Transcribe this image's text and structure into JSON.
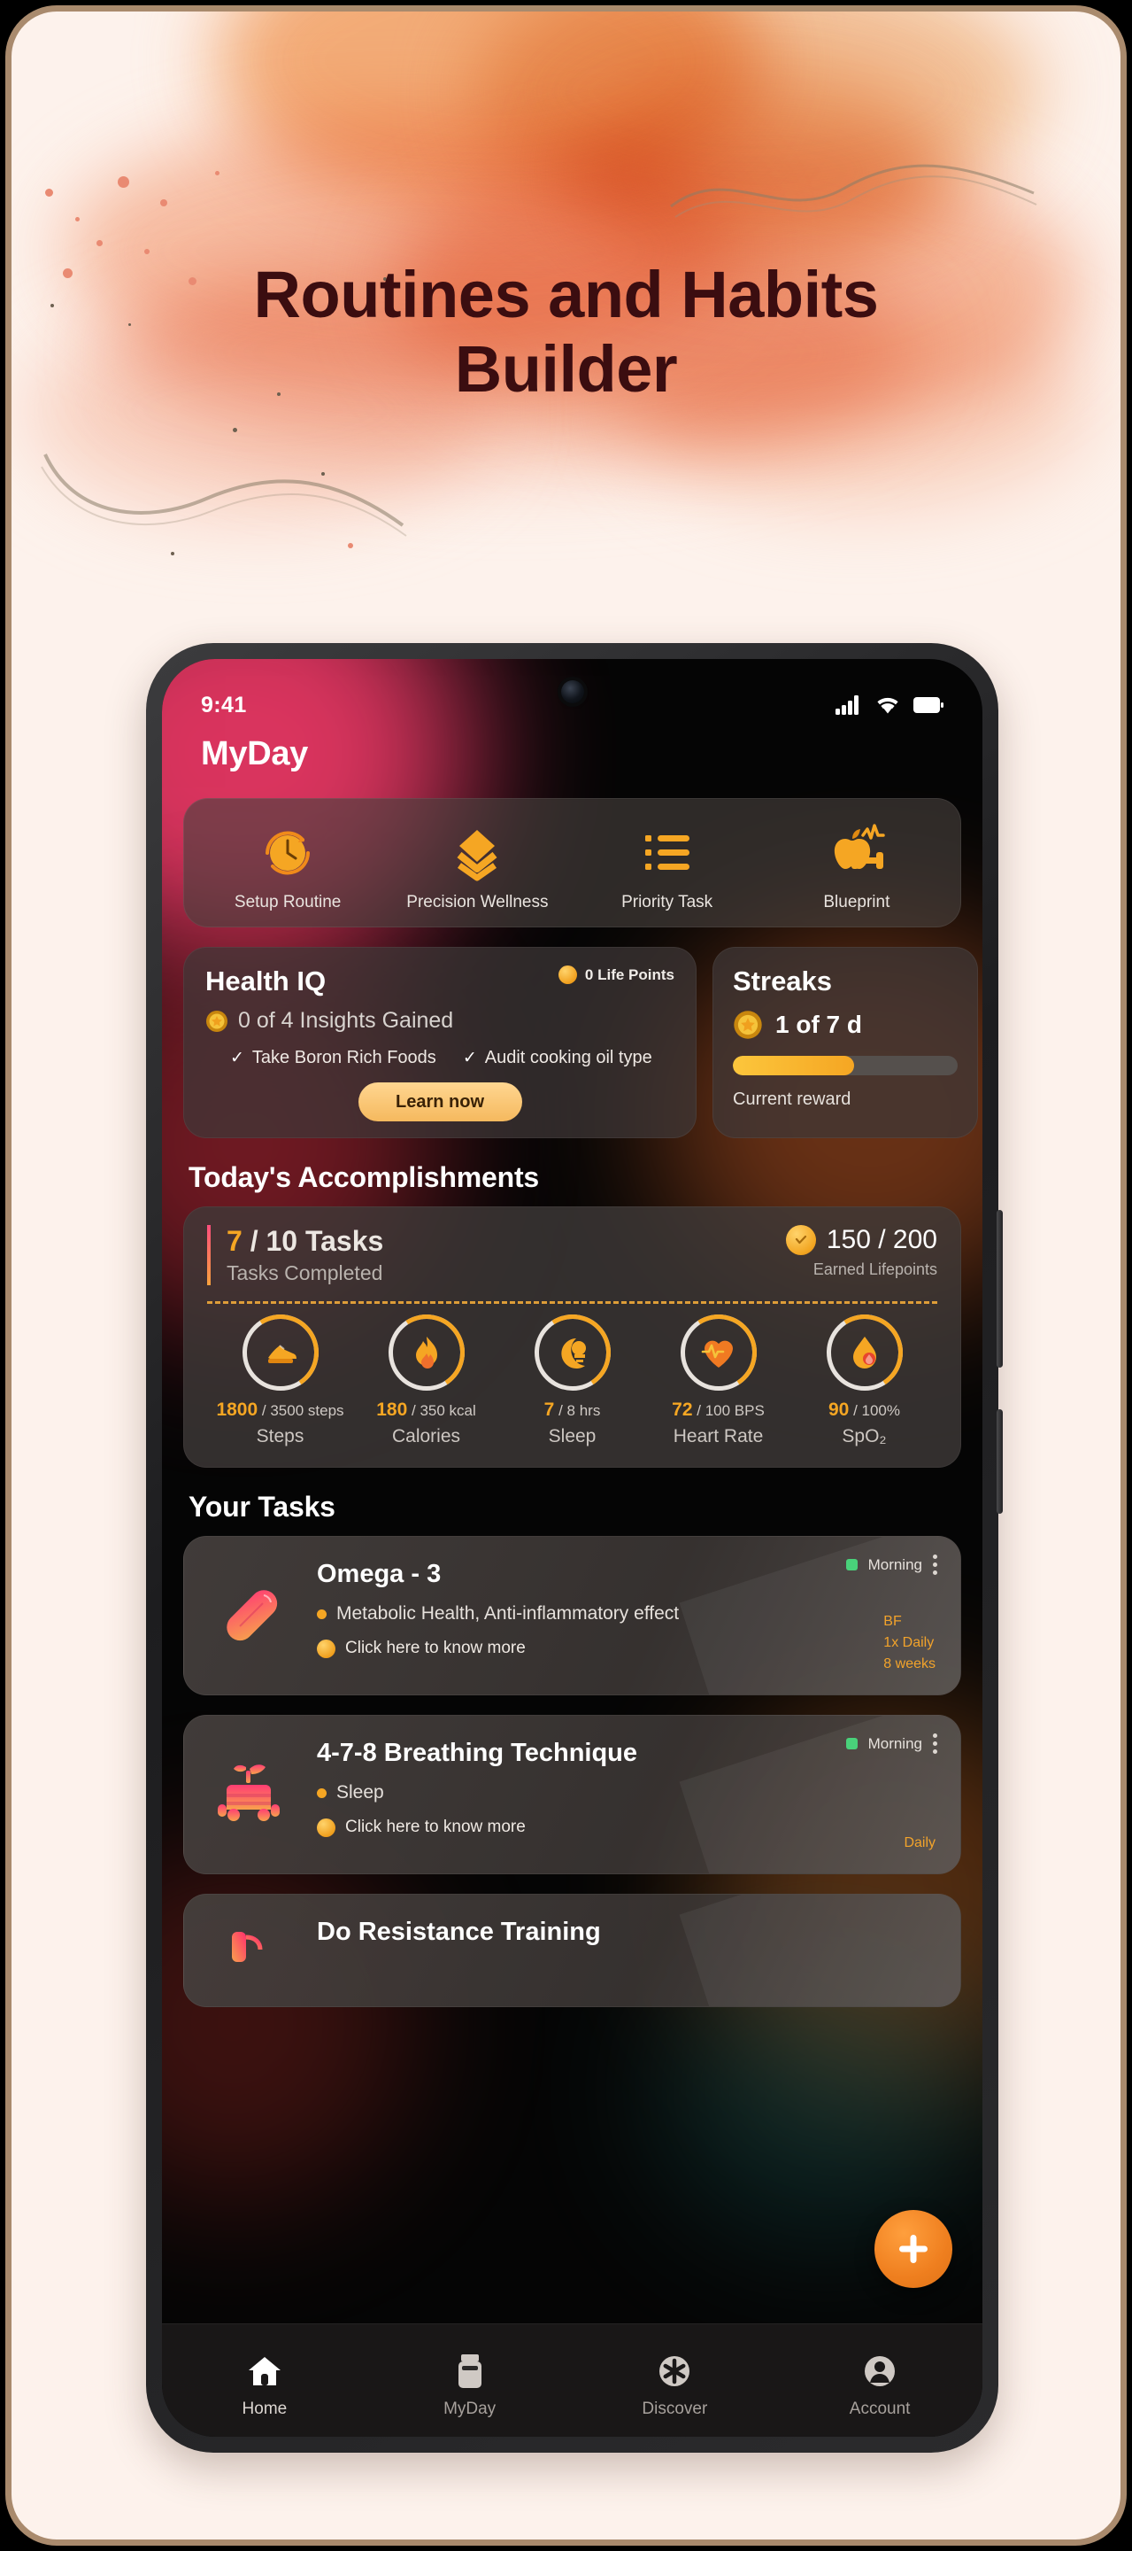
{
  "hero": {
    "title_line1": "Routines and Habits",
    "title_line2": "Builder"
  },
  "phone": {
    "statusbar": {
      "time": "9:41",
      "signal_icon": "cellular-signal-icon",
      "wifi_icon": "wifi-icon",
      "battery_icon": "battery-icon",
      "camera_icon": "front-camera-icon"
    },
    "app_name": "MyDay"
  },
  "quick_actions": [
    {
      "label": "Setup Routine",
      "icon": "clock-refresh-icon"
    },
    {
      "label": "Precision Wellness",
      "icon": "layers-chevron-icon"
    },
    {
      "label": "Priority Task",
      "icon": "checklist-icon"
    },
    {
      "label": "Blueprint",
      "icon": "apple-heartbeat-dumbbell-icon"
    }
  ],
  "health_iq": {
    "title": "Health IQ",
    "points": "0 Life Points",
    "points_icon": "lifepoint-coin-icon",
    "insights": "0 of 4 Insights Gained",
    "insights_icon": "badge-star-icon",
    "chips": [
      "Take Boron Rich Foods",
      "Audit cooking oil type"
    ],
    "cta": "Learn now"
  },
  "streaks": {
    "title": "Streaks",
    "count": "1 of 7 d",
    "count_icon": "badge-star-icon",
    "progress_percent": 54,
    "note": "Current reward"
  },
  "accomplishments": {
    "heading": "Today's Accomplishments",
    "tasks_done": "7",
    "tasks_total": "/ 10 Tasks",
    "tasks_sub": "Tasks Completed",
    "points": "150 / 200",
    "points_icon": "lifepoint-coin-icon",
    "points_sub": "Earned Lifepoints",
    "metrics": [
      {
        "label": "Steps",
        "value": "1800",
        "target": "/ 3500 steps",
        "icon": "shoe-icon",
        "percent": 51
      },
      {
        "label": "Calories",
        "value": "180",
        "target": "/ 350 kcal",
        "icon": "flame-icon",
        "percent": 51
      },
      {
        "label": "Sleep",
        "value": "7",
        "target": "/ 8 hrs",
        "icon": "moon-sleep-icon",
        "percent": 87
      },
      {
        "label": "Heart Rate",
        "value": "72",
        "target": "/ 100 BPS",
        "icon": "heart-pulse-icon",
        "percent": 72
      },
      {
        "label": "SpO₂",
        "value": "90",
        "target": "/ 100%",
        "icon": "blood-drop-icon",
        "percent": 90
      }
    ]
  },
  "tasks": {
    "heading": "Your Tasks",
    "items": [
      {
        "name": "Omega - 3",
        "icon": "capsule-pill-icon",
        "benefit": "Metabolic Health, Anti-inflammatory effect",
        "more": "Click here to know more",
        "tag": "Morning",
        "meta_line1": "BF",
        "meta_line2": "1x Daily",
        "meta_line3": "8 weeks"
      },
      {
        "name": "4-7-8 Breathing Technique",
        "icon": "breathing-plant-icon",
        "benefit": "Sleep",
        "more": "Click here to know more",
        "tag": "Morning",
        "meta_line1": "",
        "meta_line2": "Daily",
        "meta_line3": ""
      },
      {
        "name": "Do Resistance Training",
        "icon": "dumbbell-icon",
        "benefit": "",
        "more": "",
        "tag": "",
        "meta_line1": "",
        "meta_line2": "",
        "meta_line3": ""
      }
    ]
  },
  "fab": {
    "label": "add-task",
    "icon": "plus-icon"
  },
  "bottom_nav": [
    {
      "label": "Home",
      "icon": "home-icon",
      "active": true
    },
    {
      "label": "MyDay",
      "icon": "bottle-icon",
      "active": false
    },
    {
      "label": "Discover",
      "icon": "asterisk-icon",
      "active": false
    },
    {
      "label": "Account",
      "icon": "person-icon",
      "active": false
    }
  ],
  "colors": {
    "accent": "#f5a623",
    "brand_orange": "#ef7f1f",
    "pink": "#ff3d6e",
    "title": "#3b0d10",
    "page_bg": "#fdf2ec"
  }
}
